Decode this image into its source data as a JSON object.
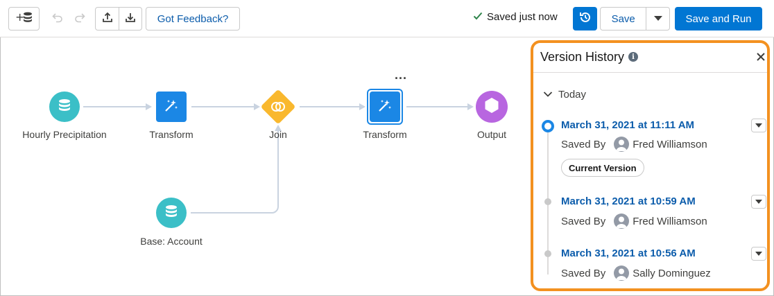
{
  "toolbar": {
    "add_data_icon": "add-dataset-icon",
    "undo_icon": "undo-icon",
    "redo_icon": "redo-icon",
    "upload_icon": "upload-icon",
    "download_icon": "download-icon",
    "feedback_label": "Got Feedback?",
    "saved_status": "Saved just now",
    "history_icon": "version-history-icon",
    "save_label": "Save",
    "save_run_label": "Save and Run"
  },
  "canvas": {
    "nodes": [
      {
        "label": "Hourly Precipitation",
        "type": "input-dataset"
      },
      {
        "label": "Transform",
        "type": "transform"
      },
      {
        "label": "Join",
        "type": "join"
      },
      {
        "label": "Transform",
        "type": "transform",
        "selected": true
      },
      {
        "label": "Output",
        "type": "output"
      },
      {
        "label": "Base: Account",
        "type": "input-dataset"
      }
    ],
    "node_menu": "..."
  },
  "panel": {
    "title": "Version History",
    "section": "Today",
    "versions": [
      {
        "date": "March 31, 2021 at 11:11 AM",
        "saved_by_label": "Saved By",
        "user": "Fred Williamson",
        "badge": "Current Version"
      },
      {
        "date": "March 31, 2021 at 10:59 AM",
        "saved_by_label": "Saved By",
        "user": "Fred Williamson"
      },
      {
        "date": "March 31, 2021 at 10:56 AM",
        "saved_by_label": "Saved By",
        "user": "Sally Dominguez"
      }
    ]
  },
  "colors": {
    "brand_blue": "#0176d3",
    "link_blue": "#0b5cab",
    "highlight_orange": "#f39120",
    "dataset_teal": "#3bbfc7",
    "join_yellow": "#f9b82e",
    "output_purple": "#b866e0",
    "success_green": "#2e844a"
  }
}
